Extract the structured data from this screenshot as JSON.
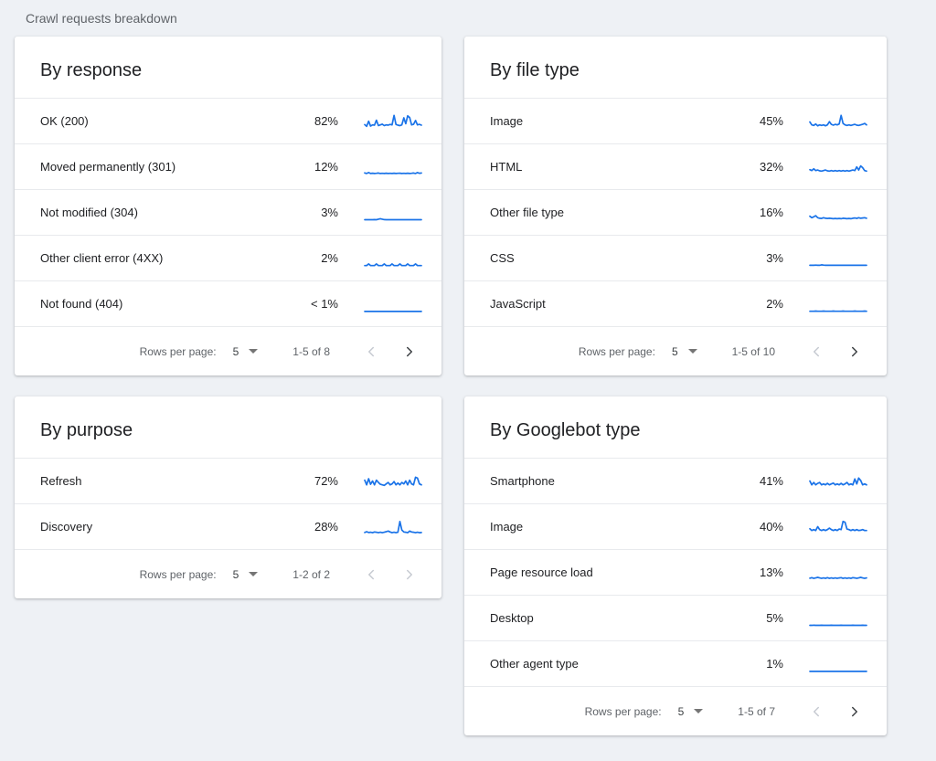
{
  "page": {
    "title": "Crawl requests breakdown"
  },
  "colors": {
    "spark_blue": "#1a73e8",
    "background": "#eef1f5",
    "divider": "#e8eaed",
    "chevron_enabled": "#3c4043",
    "chevron_disabled": "#c6cad1"
  },
  "cards": [
    {
      "title": "By response",
      "rows": [
        {
          "label": "OK (200)",
          "value": "82%",
          "spark": [
            0.32,
            0.2,
            0.55,
            0.22,
            0.3,
            0.28,
            0.62,
            0.25,
            0.3,
            0.35,
            0.25,
            0.3,
            0.28,
            0.33,
            0.3,
            0.95,
            0.33,
            0.28,
            0.25,
            0.3,
            0.78,
            0.38,
            0.92,
            0.8,
            0.3,
            0.34,
            0.6,
            0.3,
            0.34,
            0.28
          ]
        },
        {
          "label": "Moved permanently (301)",
          "value": "12%",
          "spark": [
            0.14,
            0.1,
            0.16,
            0.1,
            0.12,
            0.1,
            0.11,
            0.13,
            0.1,
            0.11,
            0.1,
            0.12,
            0.1,
            0.11,
            0.1,
            0.12,
            0.1,
            0.11,
            0.12,
            0.1,
            0.11,
            0.1,
            0.12,
            0.1,
            0.11,
            0.13,
            0.1,
            0.16,
            0.11,
            0.13
          ]
        },
        {
          "label": "Not modified (304)",
          "value": "3%",
          "spark": [
            0.06,
            0.06,
            0.06,
            0.06,
            0.06,
            0.07,
            0.06,
            0.1,
            0.13,
            0.1,
            0.07,
            0.06,
            0.06,
            0.06,
            0.06,
            0.06,
            0.06,
            0.06,
            0.06,
            0.06,
            0.06,
            0.06,
            0.06,
            0.06,
            0.06,
            0.06,
            0.06,
            0.06,
            0.06,
            0.06
          ]
        },
        {
          "label": "Other client error (4XX)",
          "value": "2%",
          "spark": [
            0.05,
            0.05,
            0.16,
            0.05,
            0.05,
            0.05,
            0.16,
            0.05,
            0.05,
            0.05,
            0.16,
            0.05,
            0.05,
            0.05,
            0.16,
            0.05,
            0.05,
            0.05,
            0.16,
            0.05,
            0.05,
            0.05,
            0.16,
            0.05,
            0.05,
            0.05,
            0.16,
            0.05,
            0.05,
            0.05
          ]
        },
        {
          "label": "Not found (404)",
          "value": "< 1%",
          "spark": [
            0.04,
            0.04,
            0.04,
            0.04,
            0.04,
            0.04,
            0.04,
            0.04,
            0.04,
            0.04,
            0.04,
            0.04,
            0.04,
            0.04,
            0.04,
            0.04,
            0.04,
            0.04,
            0.04,
            0.04,
            0.04,
            0.04,
            0.04,
            0.04,
            0.04,
            0.04,
            0.04,
            0.04,
            0.04,
            0.04
          ]
        }
      ],
      "pagination": {
        "rows_per_page_label": "Rows per page:",
        "rows_per_page_value": "5",
        "range": "1-5 of 8",
        "prev_enabled": false,
        "next_enabled": true
      }
    },
    {
      "title": "By file type",
      "rows": [
        {
          "label": "Image",
          "value": "45%",
          "spark": [
            0.5,
            0.3,
            0.26,
            0.36,
            0.24,
            0.3,
            0.26,
            0.3,
            0.24,
            0.3,
            0.52,
            0.34,
            0.28,
            0.34,
            0.3,
            0.36,
            0.95,
            0.4,
            0.3,
            0.26,
            0.3,
            0.26,
            0.3,
            0.34,
            0.28,
            0.26,
            0.3,
            0.34,
            0.4,
            0.3
          ]
        },
        {
          "label": "HTML",
          "value": "32%",
          "spark": [
            0.36,
            0.3,
            0.42,
            0.3,
            0.34,
            0.28,
            0.26,
            0.3,
            0.34,
            0.28,
            0.26,
            0.3,
            0.26,
            0.3,
            0.26,
            0.3,
            0.26,
            0.3,
            0.26,
            0.3,
            0.26,
            0.3,
            0.34,
            0.3,
            0.55,
            0.34,
            0.62,
            0.5,
            0.3,
            0.26
          ]
        },
        {
          "label": "Other file type",
          "value": "16%",
          "spark": [
            0.3,
            0.2,
            0.26,
            0.34,
            0.2,
            0.16,
            0.15,
            0.2,
            0.16,
            0.15,
            0.16,
            0.15,
            0.13,
            0.15,
            0.13,
            0.15,
            0.13,
            0.16,
            0.15,
            0.13,
            0.15,
            0.13,
            0.16,
            0.18,
            0.15,
            0.2,
            0.16,
            0.18,
            0.2,
            0.16
          ]
        },
        {
          "label": "CSS",
          "value": "3%",
          "spark": [
            0.07,
            0.07,
            0.07,
            0.08,
            0.07,
            0.07,
            0.1,
            0.08,
            0.07,
            0.07,
            0.07,
            0.07,
            0.07,
            0.07,
            0.07,
            0.07,
            0.07,
            0.07,
            0.07,
            0.07,
            0.07,
            0.07,
            0.07,
            0.07,
            0.07,
            0.07,
            0.07,
            0.07,
            0.07,
            0.07
          ]
        },
        {
          "label": "JavaScript",
          "value": "2%",
          "spark": [
            0.05,
            0.05,
            0.05,
            0.06,
            0.05,
            0.05,
            0.05,
            0.06,
            0.05,
            0.05,
            0.05,
            0.05,
            0.06,
            0.05,
            0.05,
            0.05,
            0.05,
            0.06,
            0.05,
            0.05,
            0.05,
            0.05,
            0.05,
            0.06,
            0.05,
            0.05,
            0.05,
            0.05,
            0.06,
            0.05
          ]
        }
      ],
      "pagination": {
        "rows_per_page_label": "Rows per page:",
        "rows_per_page_value": "5",
        "range": "1-5 of 10",
        "prev_enabled": false,
        "next_enabled": true
      }
    },
    {
      "title": "By purpose",
      "rows": [
        {
          "label": "Refresh",
          "value": "72%",
          "spark": [
            0.62,
            0.3,
            0.72,
            0.34,
            0.56,
            0.3,
            0.62,
            0.46,
            0.34,
            0.3,
            0.26,
            0.36,
            0.46,
            0.3,
            0.36,
            0.52,
            0.3,
            0.42,
            0.3,
            0.46,
            0.36,
            0.56,
            0.3,
            0.62,
            0.36,
            0.3,
            0.82,
            0.76,
            0.36,
            0.3
          ]
        },
        {
          "label": "Discovery",
          "value": "28%",
          "spark": [
            0.16,
            0.22,
            0.16,
            0.18,
            0.15,
            0.2,
            0.18,
            0.15,
            0.18,
            0.15,
            0.18,
            0.22,
            0.26,
            0.2,
            0.15,
            0.18,
            0.15,
            0.18,
            0.92,
            0.34,
            0.2,
            0.18,
            0.15,
            0.26,
            0.2,
            0.18,
            0.15,
            0.18,
            0.15,
            0.16
          ]
        }
      ],
      "pagination": {
        "rows_per_page_label": "Rows per page:",
        "rows_per_page_value": "5",
        "range": "1-2 of 2",
        "prev_enabled": false,
        "next_enabled": false
      }
    },
    {
      "title": "By Googlebot type",
      "rows": [
        {
          "label": "Smartphone",
          "value": "41%",
          "spark": [
            0.56,
            0.3,
            0.46,
            0.3,
            0.4,
            0.46,
            0.3,
            0.36,
            0.3,
            0.4,
            0.3,
            0.36,
            0.42,
            0.3,
            0.36,
            0.3,
            0.4,
            0.3,
            0.36,
            0.46,
            0.3,
            0.36,
            0.3,
            0.7,
            0.36,
            0.76,
            0.6,
            0.3,
            0.36,
            0.3
          ]
        },
        {
          "label": "Image",
          "value": "40%",
          "spark": [
            0.42,
            0.3,
            0.36,
            0.3,
            0.56,
            0.36,
            0.3,
            0.36,
            0.3,
            0.36,
            0.46,
            0.36,
            0.3,
            0.36,
            0.3,
            0.4,
            0.36,
            0.92,
            0.86,
            0.4,
            0.36,
            0.3,
            0.36,
            0.3,
            0.36,
            0.3,
            0.32,
            0.36,
            0.3,
            0.3
          ]
        },
        {
          "label": "Page resource load",
          "value": "13%",
          "spark": [
            0.16,
            0.2,
            0.15,
            0.18,
            0.22,
            0.18,
            0.15,
            0.18,
            0.15,
            0.2,
            0.15,
            0.18,
            0.15,
            0.18,
            0.15,
            0.18,
            0.2,
            0.15,
            0.18,
            0.15,
            0.18,
            0.15,
            0.2,
            0.18,
            0.15,
            0.18,
            0.22,
            0.18,
            0.15,
            0.18
          ]
        },
        {
          "label": "Desktop",
          "value": "5%",
          "spark": [
            0.06,
            0.06,
            0.07,
            0.06,
            0.06,
            0.06,
            0.07,
            0.06,
            0.06,
            0.06,
            0.06,
            0.07,
            0.06,
            0.06,
            0.06,
            0.06,
            0.07,
            0.06,
            0.06,
            0.06,
            0.06,
            0.06,
            0.07,
            0.06,
            0.06,
            0.06,
            0.06,
            0.07,
            0.06,
            0.06
          ]
        },
        {
          "label": "Other agent type",
          "value": "1%",
          "spark": [
            0.04,
            0.04,
            0.04,
            0.04,
            0.04,
            0.04,
            0.04,
            0.04,
            0.04,
            0.04,
            0.04,
            0.04,
            0.04,
            0.04,
            0.04,
            0.04,
            0.04,
            0.04,
            0.04,
            0.04,
            0.04,
            0.04,
            0.04,
            0.04,
            0.04,
            0.04,
            0.04,
            0.04,
            0.04,
            0.04
          ]
        }
      ],
      "pagination": {
        "rows_per_page_label": "Rows per page:",
        "rows_per_page_value": "5",
        "range": "1-5 of 7",
        "prev_enabled": false,
        "next_enabled": true
      }
    }
  ]
}
